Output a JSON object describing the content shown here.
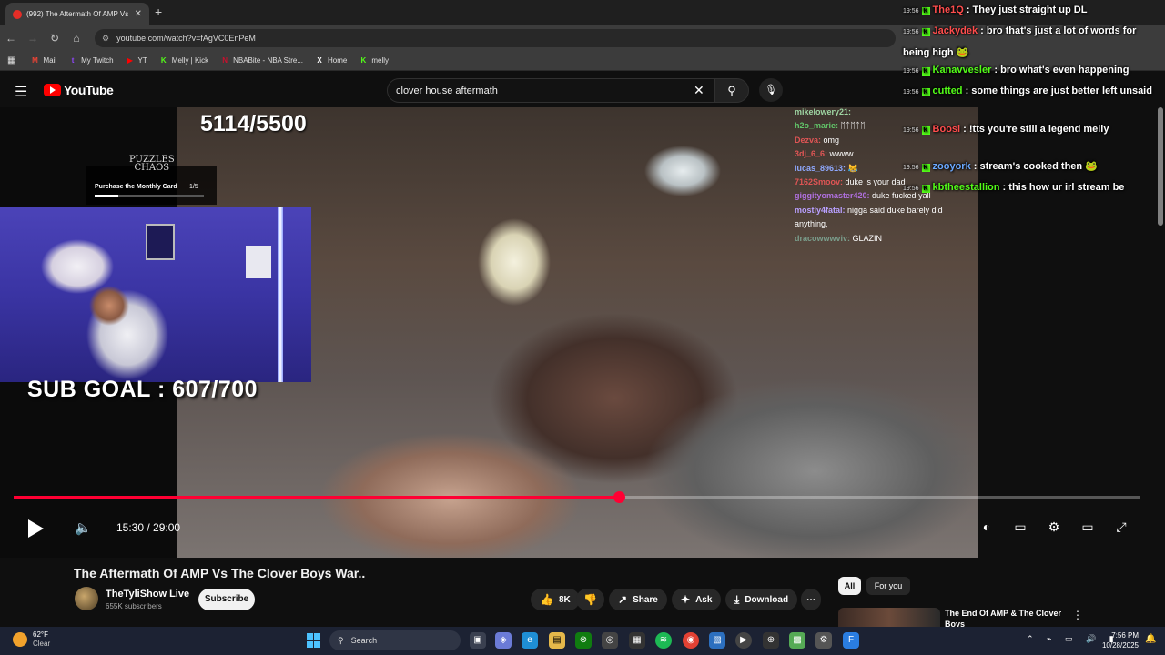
{
  "browser": {
    "tab_title": "(992) The Aftermath Of AMP Vs",
    "tab_close": "✕",
    "new_tab": "+",
    "url": "youtube.com/watch?v=fAgVC0EnPeM",
    "bookmarks": [
      {
        "label": "Mail",
        "icon": "gmail-icon",
        "glyph": "M",
        "color": "#ea4335"
      },
      {
        "label": "My Twitch",
        "icon": "twitch-icon",
        "glyph": "t",
        "color": "#9146ff"
      },
      {
        "label": "YT",
        "icon": "youtube-icon",
        "glyph": "▶",
        "color": "#ff0000"
      },
      {
        "label": "Melly | Kick",
        "icon": "kick-icon",
        "glyph": "K",
        "color": "#53fc18"
      },
      {
        "label": "NBABite - NBA Stre...",
        "icon": "nbabite-icon",
        "glyph": "N",
        "color": "#c8102e"
      },
      {
        "label": "Home",
        "icon": "x-icon",
        "glyph": "X",
        "color": "#ffffff"
      },
      {
        "label": "melly",
        "icon": "kick-icon",
        "glyph": "K",
        "color": "#53fc18"
      }
    ]
  },
  "youtube": {
    "logo_text": "YouTube",
    "search_value": "clover house aftermath",
    "video": {
      "stream_count": "5114/5500",
      "sub_goal": "SUB GOAL : 607/700",
      "promo_logo": "PUZZLES\nCHAOS",
      "promo_text": "Purchase the Monthly Card",
      "promo_count": "1/5",
      "promo_progress": 0.22,
      "progress": 0.537,
      "time": "15:30 / 29:00",
      "chat": [
        {
          "name": "mikelowery21:",
          "msg": "",
          "color": "#9fd6a3"
        },
        {
          "name": "h2o_marie:",
          "msg": "ᛖᛏᛖᛏᛖ",
          "color": "#62c76a"
        },
        {
          "name": "Dezva:",
          "msg": "omg",
          "color": "#e05555"
        },
        {
          "name": "3dj_6_6:",
          "msg": "wwww",
          "color": "#e05555"
        },
        {
          "name": "lucas_89613:",
          "msg": "😹",
          "color": "#8fa9ff"
        },
        {
          "name": "7162Smoov:",
          "msg": "duke is your dad",
          "color": "#e05555"
        },
        {
          "name": "giggityomaster420:",
          "msg": "duke fucked yall",
          "color": "#b070e0"
        },
        {
          "name": "mostly4fatal:",
          "msg": "nigga said duke barely did anything,",
          "color": "#b9a0ff"
        },
        {
          "name": "dracowwwviv:",
          "msg": "GLAZIN",
          "color": "#7a9e8c"
        }
      ]
    },
    "title": "The Aftermath Of AMP Vs The Clover Boys War..",
    "channel": "TheTyliShow Live",
    "subscribers": "655K subscribers",
    "subscribe": "Subscribe",
    "likes": "8K",
    "share": "Share",
    "ask": "Ask",
    "download": "Download",
    "chips": [
      "All",
      "For you"
    ],
    "rec_title": "The End Of AMP & The Clover Boys"
  },
  "overlay_chat": [
    {
      "time": "19:56",
      "user": "The1Q",
      "msg": ": They just straight up DL",
      "color": "#ff4d4d"
    },
    {
      "time": "19:56",
      "user": "Jackydek",
      "msg": ": bro that's just a lot of words for being high 🐸",
      "color": "#ff4d4d"
    },
    {
      "time": "19:56",
      "user": "Kanavvesler",
      "msg": ": bro what's even happening",
      "color": "#53fc18"
    },
    {
      "time": "19:56",
      "user": "cutted",
      "msg": ": some things are just better left unsaid",
      "color": "#53fc18"
    },
    {
      "time": "19:56",
      "user": "Boosi",
      "msg": ": !tts you're still a legend melly",
      "color": "#ff4d4d"
    },
    {
      "time": "19:56",
      "user": "zooyork",
      "msg": ": stream's cooked then 🐸",
      "color": "#6aa8ff"
    },
    {
      "time": "19:56",
      "user": "kbtheestallion",
      "msg": ": this how ur irl stream be",
      "color": "#53fc18"
    }
  ],
  "taskbar": {
    "temp": "62°F",
    "condition": "Clear",
    "search": "Search",
    "time": "7:56 PM",
    "date": "10/28/2025"
  },
  "colors": {
    "accent": "#ff0033",
    "bg": "#0f0f0f",
    "kick": "#53fc18"
  }
}
